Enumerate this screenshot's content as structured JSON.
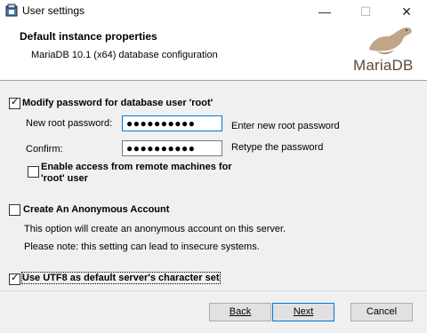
{
  "window": {
    "title": "User settings",
    "minimize_glyph": "—",
    "maximize_glyph": "☐",
    "close_glyph": "✕"
  },
  "header": {
    "title": "Default instance properties",
    "subtitle": "MariaDB 10.1 (x64) database configuration",
    "logo_text": "MariaDB"
  },
  "modify_password": {
    "checked": true,
    "label": "Modify password for database user 'root'",
    "new_root_label": "New root password:",
    "new_root_value": "●●●●●●●●●●",
    "new_root_hint": "Enter new root password",
    "confirm_label": "Confirm:",
    "confirm_value": "●●●●●●●●●●",
    "confirm_hint": "Retype the password",
    "remote_access_checked": false,
    "remote_access_label_line1": "Enable access from remote machines for",
    "remote_access_label_line2": "'root' user"
  },
  "anonymous": {
    "checked": false,
    "label": "Create An Anonymous Account",
    "desc1": "This option will create an anonymous account on this server.",
    "desc2": "Please note: this setting can lead to insecure systems."
  },
  "utf8": {
    "checked": true,
    "label": "Use UTF8 as default server's character set"
  },
  "buttons": {
    "back": "Back",
    "next": "Next",
    "cancel": "Cancel"
  },
  "colors": {
    "accent": "#0078d7",
    "logo": "#5a4a3a"
  },
  "icons": {
    "app": "installer-icon",
    "logo": "mariadb-seal-logo"
  }
}
